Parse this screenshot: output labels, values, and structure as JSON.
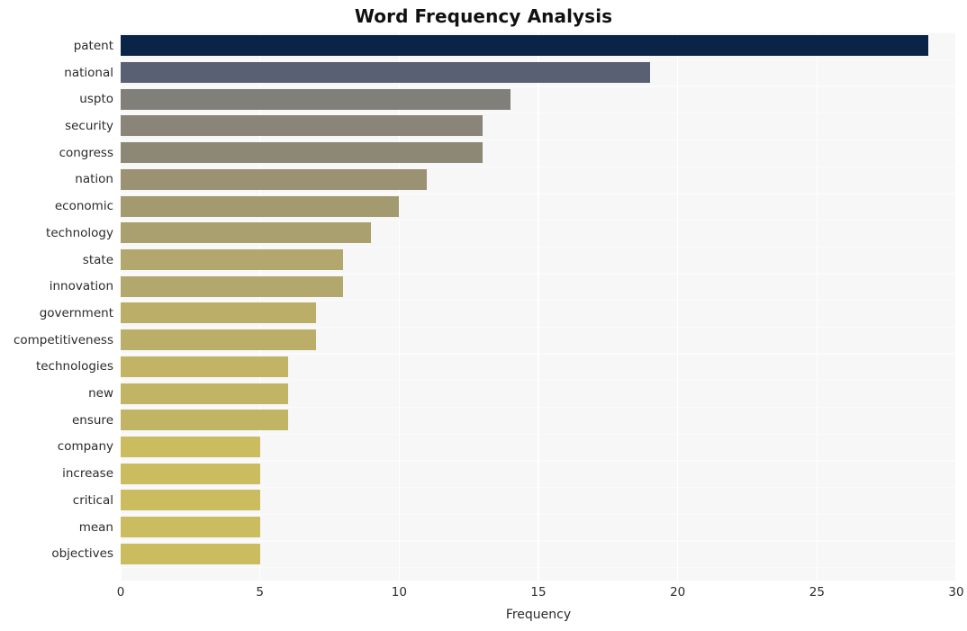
{
  "chart_data": {
    "type": "bar",
    "orientation": "horizontal",
    "title": "Word Frequency Analysis",
    "xlabel": "Frequency",
    "ylabel": "",
    "xlim": [
      0,
      30
    ],
    "xticks": [
      0,
      5,
      10,
      15,
      20,
      25,
      30
    ],
    "xtick_labels": [
      "0",
      "5",
      "10",
      "15",
      "20",
      "25",
      "30"
    ],
    "grid": true,
    "grid_axis": "x",
    "legend": false,
    "background": "#f7f7f7",
    "categories": [
      "patent",
      "national",
      "uspto",
      "security",
      "congress",
      "nation",
      "economic",
      "technology",
      "state",
      "innovation",
      "government",
      "competitiveness",
      "technologies",
      "new",
      "ensure",
      "company",
      "increase",
      "critical",
      "mean",
      "objectives"
    ],
    "values": [
      29,
      19,
      14,
      13,
      13,
      11,
      10,
      9,
      8,
      8,
      7,
      7,
      6,
      6,
      6,
      5,
      5,
      5,
      5,
      5
    ],
    "bar_colors": [
      "#0a2447",
      "#5a6073",
      "#807f7a",
      "#8a8578",
      "#8d8876",
      "#9a9272",
      "#a39a70",
      "#aaa06f",
      "#b2a86e",
      "#b2a86e",
      "#bbae68",
      "#bbae68",
      "#c2b465",
      "#c2b465",
      "#c2b465",
      "#cbbc60",
      "#cbbc60",
      "#cbbc60",
      "#cbbc60",
      "#cbbc60"
    ]
  },
  "axis": {
    "title_color": "#111111",
    "tick_color": "#2b2b2b",
    "gridline_color": "#ffffff"
  }
}
